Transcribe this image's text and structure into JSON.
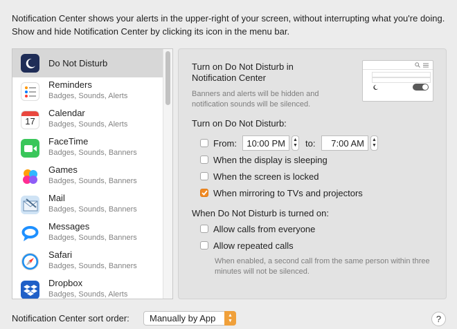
{
  "intro_text": "Notification Center shows your alerts in the upper-right of your screen, without interrupting what you're doing. Show and hide Notification Center by clicking its icon in the menu bar.",
  "apps": [
    {
      "name": "Do Not Disturb",
      "subtitle": "",
      "icon": "moon-icon"
    },
    {
      "name": "Reminders",
      "subtitle": "Badges, Sounds, Alerts",
      "icon": "reminders-icon"
    },
    {
      "name": "Calendar",
      "subtitle": "Badges, Sounds, Alerts",
      "icon": "calendar-icon",
      "icon_text": "17"
    },
    {
      "name": "FaceTime",
      "subtitle": "Badges, Sounds, Banners",
      "icon": "facetime-icon"
    },
    {
      "name": "Games",
      "subtitle": "Badges, Sounds, Banners",
      "icon": "games-icon"
    },
    {
      "name": "Mail",
      "subtitle": "Badges, Sounds, Banners",
      "icon": "mail-icon"
    },
    {
      "name": "Messages",
      "subtitle": "Badges, Sounds, Banners",
      "icon": "messages-icon"
    },
    {
      "name": "Safari",
      "subtitle": "Badges, Sounds, Banners",
      "icon": "safari-icon"
    },
    {
      "name": "Dropbox",
      "subtitle": "Badges, Sounds, Alerts",
      "icon": "dropbox-icon"
    }
  ],
  "dnd": {
    "title": "Turn on Do Not Disturb in Notification Center",
    "description": "Banners and alerts will be hidden and notification sounds will be silenced.",
    "turn_on_label": "Turn on Do Not Disturb:",
    "from_label": "From:",
    "from_value": "10:00 PM",
    "to_label": "to:",
    "to_value": "7:00 AM",
    "from_checked": false,
    "options": [
      {
        "label": "When the display is sleeping",
        "checked": false
      },
      {
        "label": "When the screen is locked",
        "checked": false
      },
      {
        "label": "When mirroring to TVs and projectors",
        "checked": true
      }
    ],
    "when_on_label": "When Do Not Disturb is turned on:",
    "call_options": [
      {
        "label": "Allow calls from everyone",
        "checked": false
      },
      {
        "label": "Allow repeated calls",
        "checked": false
      }
    ],
    "note": "When enabled, a second call from the same person within three minutes will not be silenced."
  },
  "footer": {
    "sort_label": "Notification Center sort order:",
    "sort_value": "Manually by App",
    "help_label": "?"
  },
  "colors": {
    "accent": "#f08a24",
    "selected_row": "#d7d7d7",
    "panel_bg": "#e3e3e3"
  }
}
